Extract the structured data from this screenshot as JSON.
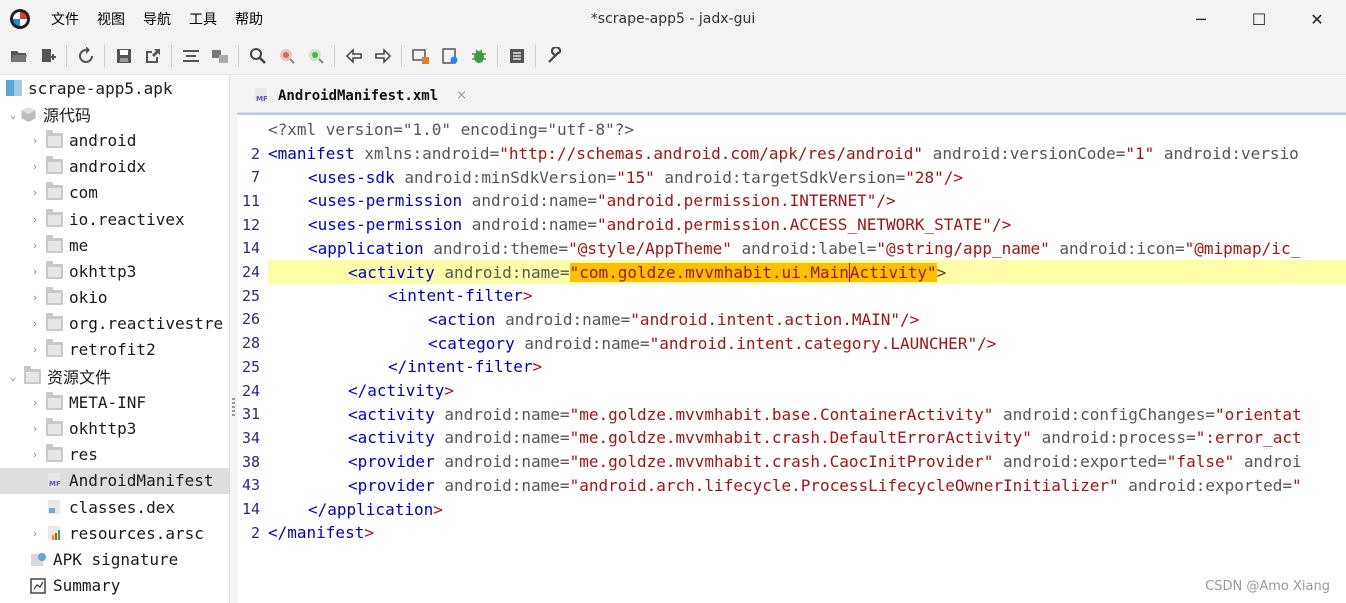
{
  "window": {
    "title": "*scrape-app5 - jadx-gui",
    "menus": [
      "文件",
      "视图",
      "导航",
      "工具",
      "帮助"
    ],
    "controls": {
      "minimize": "─",
      "maximize": "☐",
      "close": "✕"
    }
  },
  "toolbar": {
    "buttons": [
      "open-file-icon",
      "add-files-icon",
      "sync-icon",
      "save-icon",
      "export-icon",
      "flatten-packages-icon",
      "sync-tree-icon",
      "search-icon",
      "find-class-icon",
      "find-usage-icon",
      "back-icon",
      "forward-icon",
      "deobfuscation-icon",
      "quark-icon",
      "debug-icon",
      "log-icon",
      "preferences-icon"
    ]
  },
  "tree": {
    "root": "scrape-app5.apk",
    "source_label": "源代码",
    "packages": [
      "android",
      "androidx",
      "com",
      "io.reactivex",
      "me",
      "okhttp3",
      "okio",
      "org.reactivestre",
      "retrofit2"
    ],
    "resources_label": "资源文件",
    "resource_items": [
      "META-INF",
      "okhttp3",
      "res"
    ],
    "manifest": "AndroidManifest",
    "classes": "classes.dex",
    "arsc": "resources.arsc",
    "signature": "APK signature",
    "summary": "Summary"
  },
  "editor": {
    "tab_label": "AndroidManifest.xml",
    "tab_close": "×",
    "line_numbers": [
      "",
      "2",
      "7",
      "11",
      "12",
      "14",
      "24",
      "25",
      "26",
      "28",
      "25",
      "24",
      "31",
      "34",
      "38",
      "43",
      "14",
      "2"
    ],
    "lines": {
      "l0": "<?xml version=\"1.0\" encoding=\"utf-8\"?>",
      "l1_tag": "<manifest",
      "l1_a1": " xmlns:android=",
      "l1_v1": "\"http://schemas.android.com/apk/res/android\"",
      "l1_a2": " android:versionCode=",
      "l1_v2": "\"1\"",
      "l1_a3": " android:versio",
      "l2_tag": "<uses-sdk",
      "l2_a1": " android:minSdkVersion=",
      "l2_v1": "\"15\"",
      "l2_a2": " android:targetSdkVersion=",
      "l2_v2": "\"28\"",
      "l2_end": "/>",
      "l3_tag": "<uses-permission",
      "l3_a1": " android:name=",
      "l3_v1": "\"android.permission.INTERNET\"",
      "l3_end": "/>",
      "l4_tag": "<uses-permission",
      "l4_a1": " android:name=",
      "l4_v1": "\"android.permission.ACCESS_NETWORK_STATE\"",
      "l4_end": "/>",
      "l5_tag": "<application",
      "l5_a1": " android:theme=",
      "l5_v1": "\"@style/AppTheme\"",
      "l5_a2": " android:label=",
      "l5_v2": "\"@string/app_name\"",
      "l5_a3": " android:icon=",
      "l5_v3": "\"@mipmap/ic_",
      "l6_tag": "<activity",
      "l6_a1": " android:name=",
      "l6_v1a": "\"com.goldze.mvvmhabit.ui.Main",
      "l6_v1b": "Activity\"",
      "l6_end": ">",
      "l7_tag": "<intent-filter",
      "l7_end": ">",
      "l8_tag": "<action",
      "l8_a1": " android:name=",
      "l8_v1": "\"android.intent.action.MAIN\"",
      "l8_end": "/>",
      "l9_tag": "<category",
      "l9_a1": " android:name=",
      "l9_v1": "\"android.intent.category.LAUNCHER\"",
      "l9_end": "/>",
      "l10_tag": "</intent-filter",
      "l10_end": ">",
      "l11_tag": "</activity",
      "l11_end": ">",
      "l12_tag": "<activity",
      "l12_a1": " android:name=",
      "l12_v1": "\"me.goldze.mvvmhabit.base.ContainerActivity\"",
      "l12_a2": " android:configChanges=",
      "l12_v2": "\"orientat",
      "l13_tag": "<activity",
      "l13_a1": " android:name=",
      "l13_v1": "\"me.goldze.mvvmhabit.crash.DefaultErrorActivity\"",
      "l13_a2": " android:process=",
      "l13_v2": "\":error_act",
      "l14_tag": "<provider",
      "l14_a1": " android:name=",
      "l14_v1": "\"me.goldze.mvvmhabit.crash.CaocInitProvider\"",
      "l14_a2": " android:exported=",
      "l14_v2": "\"false\"",
      "l14_a3": " androi",
      "l15_tag": "<provider",
      "l15_a1": " android:name=",
      "l15_v1": "\"android.arch.lifecycle.ProcessLifecycleOwnerInitializer\"",
      "l15_a2": " android:exported=",
      "l15_v2": "\"",
      "l16_tag": "</application",
      "l16_end": ">",
      "l17_tag": "</manifest",
      "l17_end": ">"
    }
  },
  "watermark": "CSDN @Amo Xiang",
  "colors": {
    "tag": "#0000c8",
    "attr": "#555555",
    "value": "#a31515",
    "highlight_line": "#ffffaa",
    "selection": "#ffc000"
  }
}
